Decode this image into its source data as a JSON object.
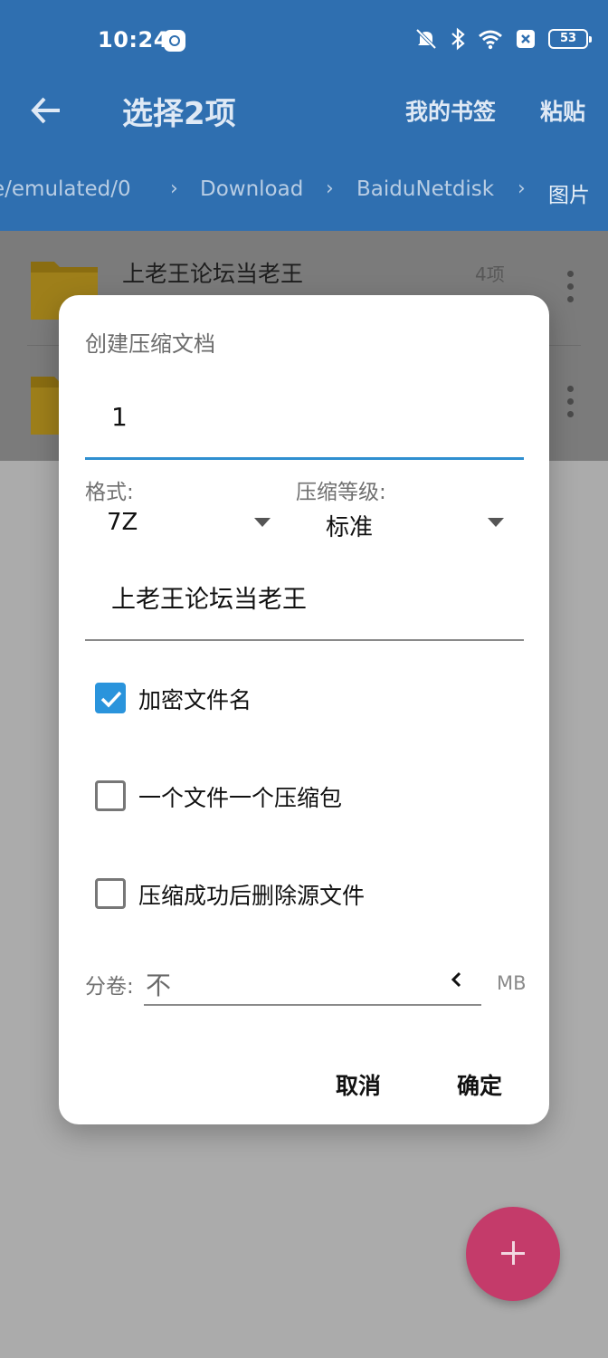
{
  "status_bar": {
    "time": "10:24",
    "battery": "53",
    "icons": [
      "app-icon",
      "silent-bell-icon",
      "bluetooth-icon",
      "wifi-icon",
      "sim-off-icon",
      "battery-icon"
    ]
  },
  "toolbar": {
    "title": "选择2项",
    "bookmarks_label": "我的书签",
    "paste_label": "粘贴"
  },
  "breadcrumb": [
    "e/emulated/0",
    "Download",
    "BaiduNetdisk",
    "图片"
  ],
  "files": [
    {
      "name": "上老王论坛当老王",
      "count": "4项"
    },
    {
      "name": "",
      "count": ""
    }
  ],
  "dialog": {
    "title": "创建压缩文档",
    "archive_name": "1",
    "format_label": "格式:",
    "format_value": "7Z",
    "level_label": "压缩等级:",
    "level_value": "标准",
    "source_name": "上老王论坛当老王",
    "options": [
      {
        "label": "加密文件名",
        "checked": true
      },
      {
        "label": "一个文件一个压缩包",
        "checked": false
      },
      {
        "label": "压缩成功后删除源文件",
        "checked": false
      }
    ],
    "split_label": "分卷:",
    "split_value": "不",
    "split_unit": "MB",
    "cancel_label": "取消",
    "ok_label": "确定"
  },
  "colors": {
    "header": "#2f6fb0",
    "accent": "#2a94dc",
    "fab": "#c43b6a",
    "folder": "#f4c01e"
  }
}
